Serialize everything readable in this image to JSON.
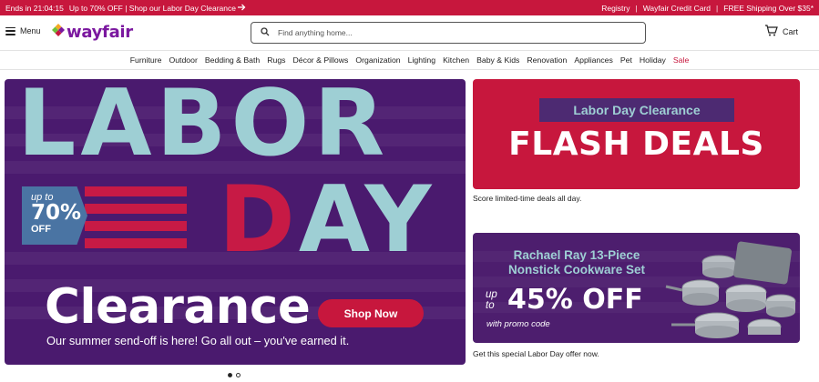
{
  "topbar": {
    "countdown": "Ends in 21:04:15",
    "promo_link": "Up to 70% OFF | Shop our Labor Day Clearance",
    "registry": "Registry",
    "credit_card": "Wayfair Credit Card",
    "shipping": "FREE Shipping Over $35*",
    "bg_color": "#c7173d"
  },
  "header": {
    "menu_label": "Menu",
    "logo_text": "wayfair",
    "search_placeholder": "Find anything home...",
    "cart_label": "Cart",
    "brand_color": "#7b189f"
  },
  "categories": [
    "Furniture",
    "Outdoor",
    "Bedding & Bath",
    "Rugs",
    "Décor & Pillows",
    "Organization",
    "Lighting",
    "Kitchen",
    "Baby & Kids",
    "Renovation",
    "Appliances",
    "Pet",
    "Holiday",
    "Sale"
  ],
  "hero": {
    "word1": "LABOR",
    "word2_d": "D",
    "word2_rest": "AY",
    "badge_upto": "up to",
    "badge_pct": "70%",
    "badge_off": "OFF",
    "headline": "Clearance",
    "button_label": "Shop Now",
    "subline": "Our summer send-off is here! Go all out – you've earned it."
  },
  "carousel": {
    "slides": 2,
    "active_index": 0
  },
  "promo1": {
    "tag": "Labor Day Clearance",
    "headline": "FLASH DEALS",
    "caption": "Score limited-time deals all day."
  },
  "promo2": {
    "title_line1": "Rachael Ray 13-Piece",
    "title_line2": "Nonstick Cookware Set",
    "upto_1": "up",
    "upto_2": "to",
    "discount": "45% OFF",
    "promo_note": "with promo code",
    "caption": "Get this special Labor Day offer now."
  }
}
